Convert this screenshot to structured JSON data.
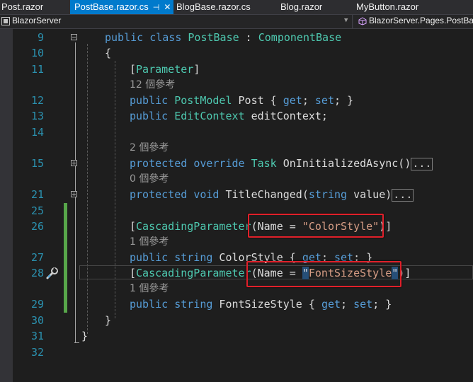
{
  "tabs": [
    {
      "label": "Post.razor",
      "active": false
    },
    {
      "label": "PostBase.razor.cs",
      "active": true,
      "pin": "⊣",
      "close": "✕"
    },
    {
      "label": "BlogBase.razor.cs",
      "active": false
    },
    {
      "label": "Blog.razor",
      "active": false
    },
    {
      "label": "MyButton.razor",
      "active": false
    }
  ],
  "nav": {
    "project": "BlazorServer",
    "type": "BlazorServer.Pages.PostBa"
  },
  "lines": [
    {
      "num": "9",
      "code": "public class PostBase : ComponentBase"
    },
    {
      "num": "10",
      "code": "{"
    },
    {
      "num": "11",
      "code": "[Parameter]"
    },
    {
      "num": "12",
      "code": "public PostModel Post { get; set; }"
    },
    {
      "num": "13",
      "code": "public EditContext editContext;"
    },
    {
      "num": "14",
      "code": ""
    },
    {
      "num": "15",
      "code": "protected override Task OnInitializedAsync()"
    },
    {
      "num": "21",
      "code": "protected void TitleChanged(string value)"
    },
    {
      "num": "25",
      "code": ""
    },
    {
      "num": "26",
      "code": "[CascadingParameter(Name = \"ColorStyle\")]"
    },
    {
      "num": "27",
      "code": "public string ColorStyle { get; set; }"
    },
    {
      "num": "28",
      "code": "[CascadingParameter(Name = \"FontSizeStyle\")]"
    },
    {
      "num": "29",
      "code": "public string FontSizeStyle { get; set; }"
    },
    {
      "num": "30",
      "code": "}"
    },
    {
      "num": "31",
      "code": "}"
    },
    {
      "num": "32",
      "code": ""
    }
  ],
  "refs": {
    "r12": "12 個參考",
    "r15": "2 個參考",
    "r21": "0 個參考",
    "r27": "1 個參考",
    "r29": "1 個參考"
  },
  "collapsed_marker": "...",
  "colors": {
    "keyword": "#569cd6",
    "type": "#4ec9b0",
    "string": "#d69d85",
    "line_number": "#2b91af",
    "highlight_box": "#e0202a",
    "active_tab": "#007acc"
  },
  "icons": {
    "glyph_margin_line28": "screwdriver-wrench-icon"
  }
}
